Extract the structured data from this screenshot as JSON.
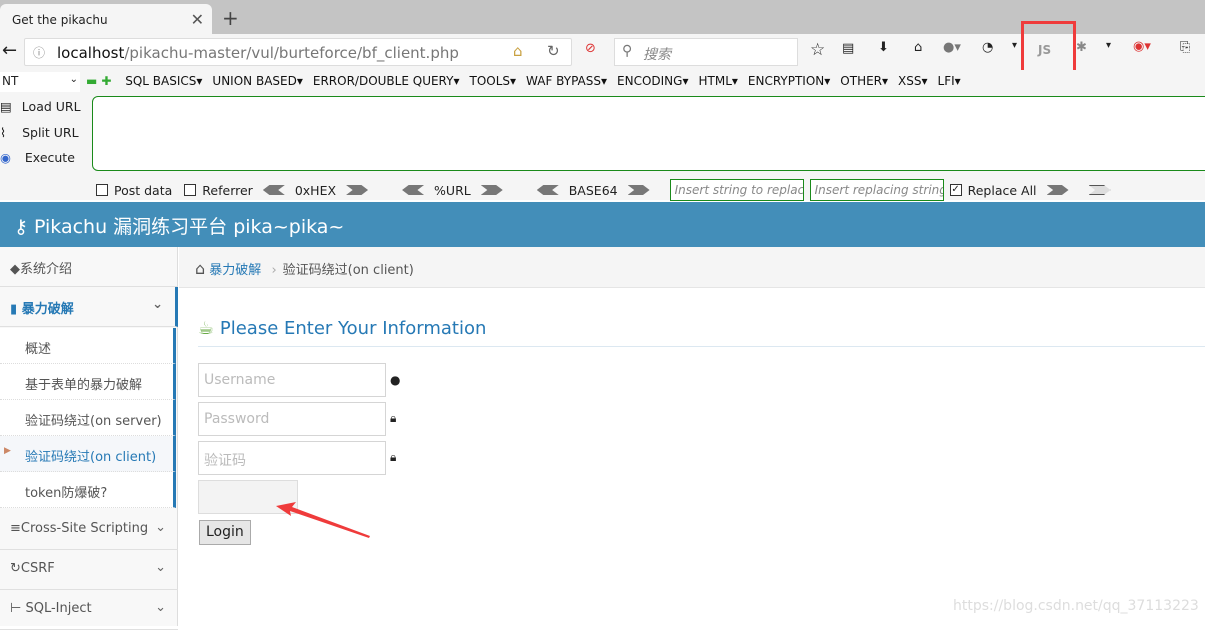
{
  "browser": {
    "tab_title": "Get the pikachu",
    "new_tab": "+",
    "url_host": "localhost",
    "url_path": "/pikachu-master/vul/burteforce/bf_client.php",
    "search_placeholder": "搜索",
    "js_label": "JS"
  },
  "hackbar": {
    "select_value": "NT",
    "menu": [
      "SQL BASICS▾",
      "UNION BASED▾",
      "ERROR/DOUBLE QUERY▾",
      "TOOLS▾",
      "WAF BYPASS▾",
      "ENCODING▾",
      "HTML▾",
      "ENCRYPTION▾",
      "OTHER▾",
      "XSS▾",
      "LFI▾"
    ],
    "load_url": "Load URL",
    "split_url": "Split URL",
    "execute": "Execute",
    "post_data": "Post data",
    "referrer": "Referrer",
    "hex": "0xHEX",
    "url": "%URL",
    "base64": "BASE64",
    "replace_placeholder": "Insert string to replace",
    "replacing_placeholder": "Insert replacing string",
    "replace_all": "Replace All",
    "replace_all_checked": true
  },
  "site": {
    "title": "Pikachu 漏洞练习平台 pika~pika~",
    "sidebar": {
      "intro": "系统介绍",
      "bruteforce": "暴力破解",
      "sub": [
        "概述",
        "基于表单的暴力破解",
        "验证码绕过(on server)",
        "验证码绕过(on client)",
        "token防爆破?"
      ],
      "xss": "Cross-Site Scripting",
      "csrf": "CSRF",
      "sqli": "SQL-Inject"
    },
    "breadcrumb": {
      "parent": "暴力破解",
      "current": "验证码绕过(on client)"
    },
    "form": {
      "title": "Please Enter Your Information",
      "username_placeholder": "Username",
      "password_placeholder": "Password",
      "captcha_placeholder": "验证码",
      "login": "Login"
    },
    "watermark": "https://blog.csdn.net/qq_37113223"
  },
  "colors": {
    "header": "#438eb9",
    "accent": "#2679b5",
    "annotation": "#ef3b3b"
  }
}
